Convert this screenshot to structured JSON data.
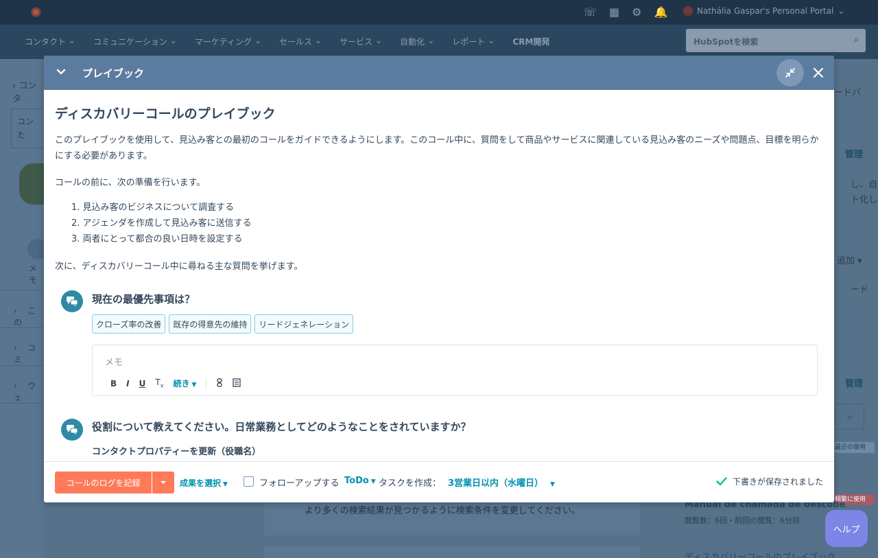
{
  "topbar": {
    "portal_name": "Nathália Gaspar's Personal Portal"
  },
  "nav": {
    "items": [
      "コンタクト",
      "コミュニケーション",
      "マーケティング",
      "セールス",
      "サービス",
      "自動化",
      "レポート",
      "CRM開発"
    ],
    "search_placeholder": "HubSpotを検索"
  },
  "background": {
    "left_crumb": "コンタ",
    "left_card_line1": "コン",
    "left_card_line2": "た",
    "left_memo": "メモ",
    "left_sections": [
      "この",
      "コミ",
      "ウェ"
    ],
    "right_texts": [
      "ードバ",
      "管理",
      "し、自",
      "ト化し",
      "追加",
      "ード",
      "管理"
    ],
    "badges": [
      "最近の使用",
      "頻繁に使用"
    ],
    "manual_title": "Manual de chamada de descobe",
    "manual_views": "閲覧数：6回・前回の閲覧：6分前",
    "discovery_title": "ディスカバリーコールのプレイブック",
    "search_hint": "より多くの検索結果が見つかるように検索条件を変更してください。",
    "help_label": "ヘルプ"
  },
  "modal": {
    "header_title": "プレイブック",
    "playbook_title": "ディスカバリーコールのプレイブック",
    "intro": "このプレイブックを使用して、見込み客との最初のコールをガイドできるようにします。このコール中に、質問をして商品やサービスに関連している見込み客のニーズや問題点、目標を明らかにする必要があります。",
    "prep_heading": "コールの前に、次の準備を行います。",
    "prep_steps": [
      "1. 見込み客のビジネスについて調査する",
      "2. アジェンダを作成して見込み客に送信する",
      "3. 両者にとって都合の良い日時を設定する"
    ],
    "next_heading": "次に、ディスカバリーコール中に尋ねる主な質問を挙げます。",
    "question1": {
      "text": "現在の最優先事項は？",
      "options": [
        "クローズ率の改善",
        "既存の得意先の維持",
        "リードジェネレーション"
      ],
      "memo_placeholder": "メモ",
      "toolbar_more": "続き"
    },
    "question2": {
      "text": "役割について教えてください。日常業務としてどのようなことをされていますか？",
      "property_update": "コンタクトプロパティーを更新（役職名）"
    }
  },
  "footer": {
    "log_call": "コールのログを記録",
    "select_outcome": "成果を選択",
    "followup_label": "フォローアップする",
    "task_type": "ToDo",
    "task_create": "タスクを作成：",
    "due": "3営業日以内（水曜日）",
    "saved_status": "下書きが保存されました"
  },
  "colors": {
    "accent": "#ff7a59",
    "link": "#0091ae",
    "header": "#5b7c9e",
    "question_icon": "#2f8aa6"
  }
}
